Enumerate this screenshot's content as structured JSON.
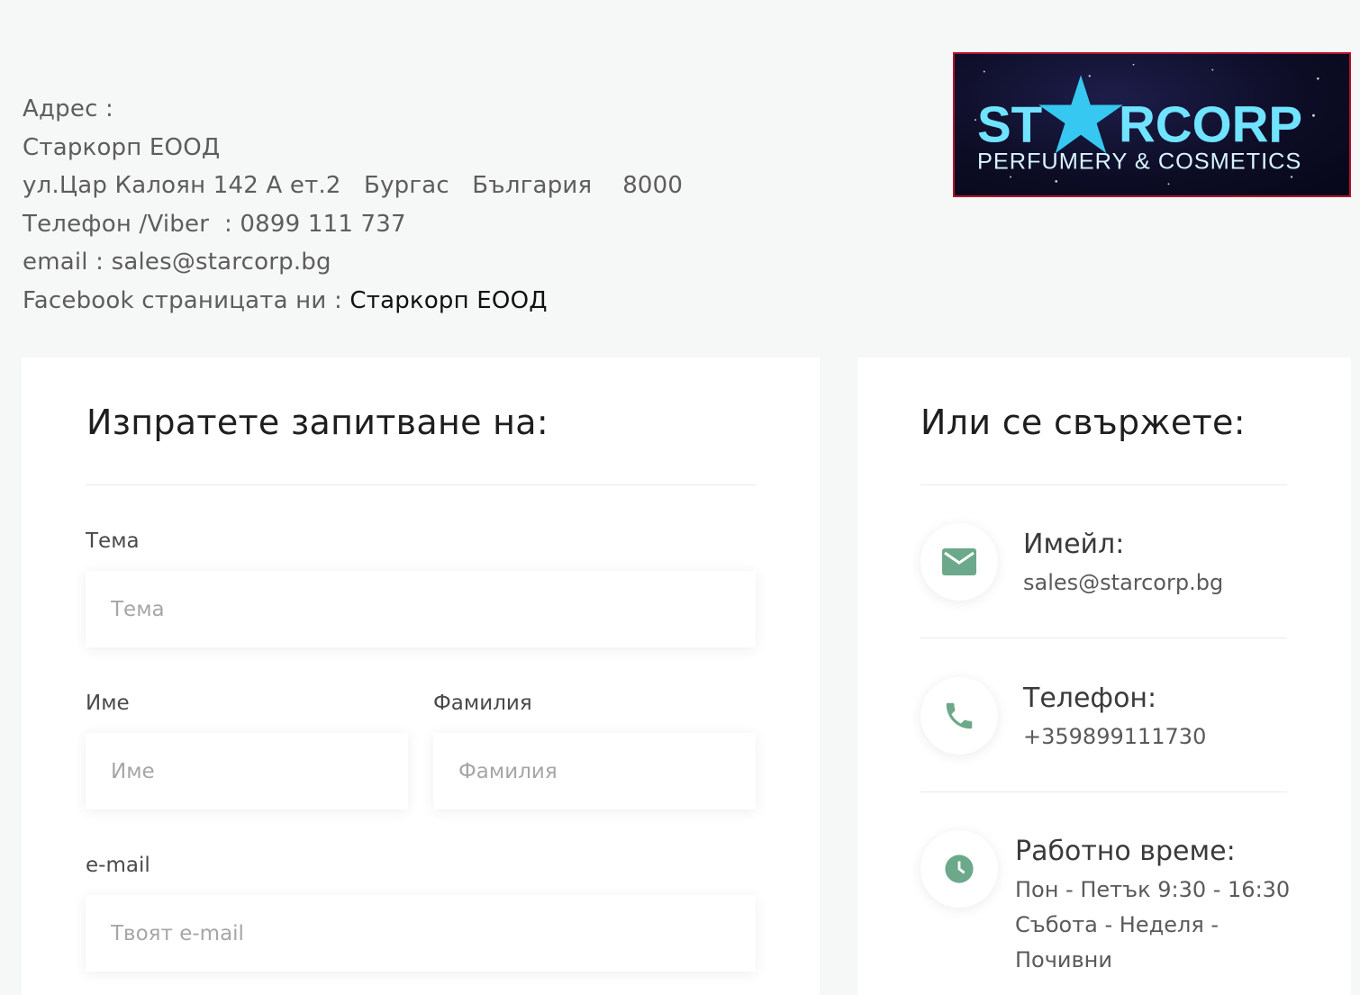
{
  "address": {
    "label": "Адрес :",
    "company": "Старкорп ЕООД",
    "street": "ул.Цар Калоян 142 А ет.2   Бургас   България    8000",
    "phone": "Телефон /Viber  : 0899 111 737",
    "email": "email : sales@starcorp.bg",
    "facebook_prefix": "Facebook страницата ни : ",
    "facebook_link": "Старкорп ЕООД"
  },
  "logo": {
    "brand_left": "ST",
    "brand_right": "RCORP",
    "tagline": "PERFUMERY & COSMETICS",
    "colors": {
      "text": "#6fe3ff",
      "background": "#0c0c24",
      "border": "#b3122a"
    }
  },
  "form": {
    "title": "Изпратете запитване на:",
    "fields": {
      "subject": {
        "label": "Тема",
        "placeholder": "Тема"
      },
      "first_name": {
        "label": "Име",
        "placeholder": "Име"
      },
      "last_name": {
        "label": "Фамилия",
        "placeholder": "Фамилия"
      },
      "email": {
        "label": "e-mail",
        "placeholder": "Твоят e-mail"
      }
    }
  },
  "contact": {
    "title": "Или се свържете:",
    "email": {
      "heading": "Имейл:",
      "value": "sales@starcorp.bg",
      "icon": "mail-icon"
    },
    "phone": {
      "heading": "Телефон:",
      "value": "+359899111730",
      "icon": "phone-icon"
    },
    "hours": {
      "heading": "Работно време:",
      "line1": "Пон - Петък 9:30 - 16:30",
      "line2": "Събота - Неделя -",
      "line3": "Почивни",
      "icon": "clock-icon"
    },
    "accent_color": "#6ba98a"
  }
}
